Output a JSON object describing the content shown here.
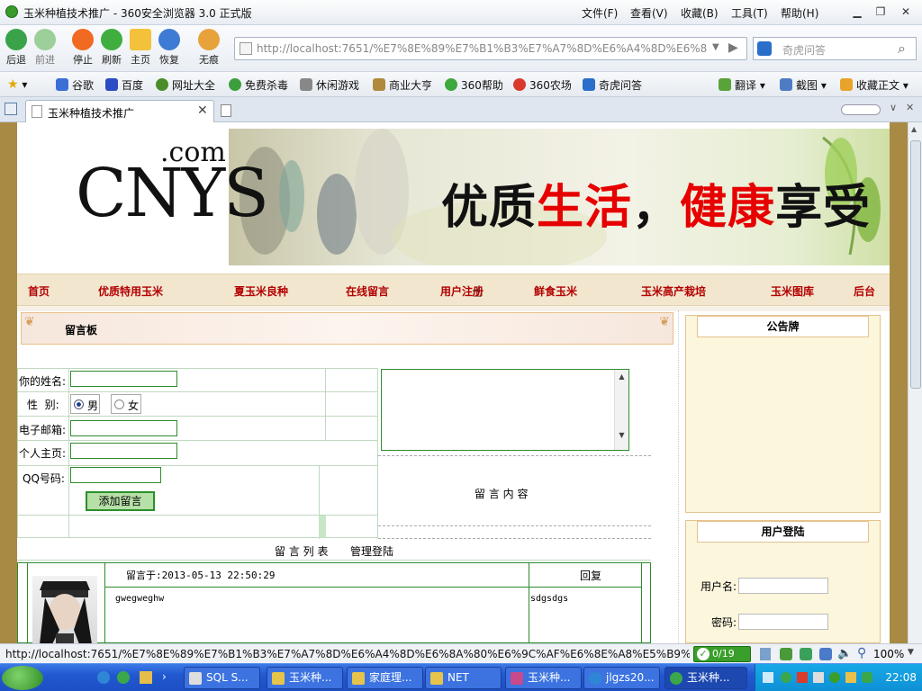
{
  "window": {
    "title": "玉米种植技术推广 - 360安全浏览器 3.0 正式版",
    "menus": [
      "文件(F)",
      "查看(V)",
      "收藏(B)",
      "工具(T)",
      "帮助(H)"
    ]
  },
  "toolbar": {
    "buttons": [
      "后退",
      "前进",
      "停止",
      "刷新",
      "主页",
      "恢复",
      "无痕"
    ],
    "address": "http://localhost:7651/%E7%8E%89%E7%B1%B3%E7%A7%8D%E6%A4%8D%E6%8A",
    "search_placeholder": "奇虎问答"
  },
  "favorites": [
    "谷歌",
    "百度",
    "网址大全",
    "免费杀毒",
    "休闲游戏",
    "商业大亨",
    "360帮助",
    "360农场",
    "奇虎问答"
  ],
  "favorites_right": [
    "翻译",
    "截图",
    "收藏正文"
  ],
  "tabs": [
    {
      "label": "玉米种植技术推广"
    }
  ],
  "site": {
    "logo_com": ".com",
    "logo": "CNYS",
    "slogan": {
      "p1": "优质",
      "p2": "生活",
      "p3": "，",
      "p4": "健康",
      "p5": "享受"
    },
    "menu": [
      "首页",
      "优质特用玉米",
      "夏玉米良种",
      "在线留言",
      "用户注册",
      "鲜食玉米",
      "玉米高产栽培",
      "玉米图库",
      "后台"
    ]
  },
  "board": {
    "title": "留言板",
    "name_label": "你的姓名:",
    "gender_label": "性  别:",
    "male": "男",
    "female": "女",
    "email_label": "电子邮箱:",
    "homepage_label": "个人主页:",
    "qq_label": "QQ号码:",
    "add_button": "添加留言",
    "content_label": "留 言 内 容",
    "list_label": "留 言 列 表",
    "admin_login": "管理登陆",
    "message": {
      "time": "留言于:2013-05-13 22:50:29",
      "reply_header": "回复",
      "content": "gwegweghw",
      "reply": "sdgsdgs"
    }
  },
  "sidebar": {
    "notice_title": "公告牌",
    "login_title": "用户登陆",
    "username_label": "用户名:",
    "password_label": "密码:"
  },
  "status": {
    "url": "http://localhost:7651/%E7%8E%89%E7%B1%B3%E7%A7%8D%E6%A4%8D%E6%8A%80%E6%9C%AF%E6%8E%A8%E5%B9%BF...",
    "counter": "0/19",
    "zoom": "100%"
  },
  "taskbar": {
    "tasks": [
      "SQL S...",
      "玉米种...",
      "家庭理...",
      "NET",
      "玉米种...",
      "jlgzs20...",
      "玉米种..."
    ],
    "clock": "22:08"
  },
  "colors": {
    "frame": "#a88a44",
    "menu_text": "#b30000",
    "slogan_red": "#e60000",
    "input_border": "#2e8b2e"
  }
}
